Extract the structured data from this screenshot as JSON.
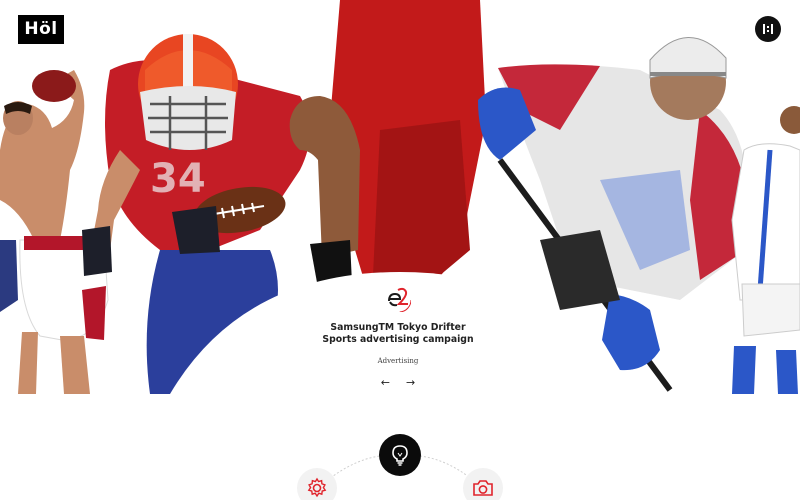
{
  "header": {
    "logo_text": "Höl",
    "menu_icon": "grid-dots-icon"
  },
  "slide": {
    "brand_icon": "e2-brand-mark",
    "title_line1": "SamsungTM Tokyo Drifter",
    "title_line2": "Sports advertising campaign",
    "category": "Advertising",
    "prev_label": "←",
    "next_label": "→"
  },
  "features": {
    "center_icon": "lightbulb-icon",
    "left_icon": "gear-icon",
    "right_icon": "camera-icon"
  },
  "colors": {
    "accent": "#e0242c",
    "dark": "#0b0b0b",
    "background": "#ffffff"
  }
}
